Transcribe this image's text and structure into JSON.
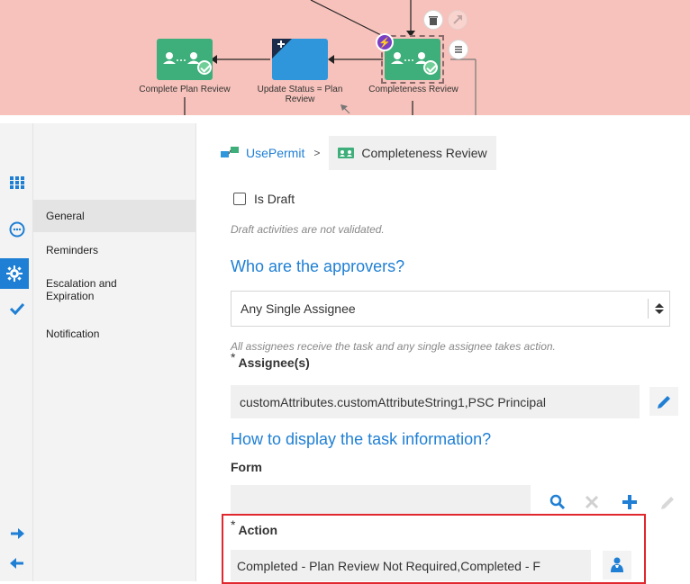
{
  "canvas": {
    "nodes": {
      "complete_plan_review": "Complete Plan Review",
      "update_status": "Update Status = Plan Review",
      "completeness_review": "Completeness Review"
    }
  },
  "rail": {
    "icons": [
      "grid-icon",
      "chat-icon",
      "gear-icon",
      "check-icon",
      "arrow-right-icon",
      "arrow-left-icon"
    ]
  },
  "nav": {
    "items": [
      {
        "label": "General"
      },
      {
        "label": "Reminders"
      },
      {
        "label": "Escalation and Expiration"
      },
      {
        "label": "Notification"
      }
    ]
  },
  "breadcrumb": {
    "root": "UsePermit",
    "separator": ">",
    "current": "Completeness Review"
  },
  "form": {
    "is_draft_label": "Is Draft",
    "draft_hint": "Draft activities are not validated.",
    "approvers_title": "Who are the approvers?",
    "approvers_value": "Any Single Assignee",
    "approvers_hint": "All assignees receive the task and any single assignee takes action.",
    "assignee_label": "Assignee(s)",
    "assignee_value": "customAttributes.customAttributeString1,PSC Principal",
    "display_title": "How to display the task information?",
    "form_label": "Form",
    "form_value": "",
    "action_label": "Action",
    "action_value": "Completed - Plan Review Not Required,Completed - F",
    "required_marker": "*"
  },
  "colors": {
    "accent": "#1f7fd4",
    "canvas_bg": "#f7c2bb",
    "node_green": "#3eae7a",
    "node_blue": "#2f96dc",
    "highlight": "#e0282e"
  }
}
